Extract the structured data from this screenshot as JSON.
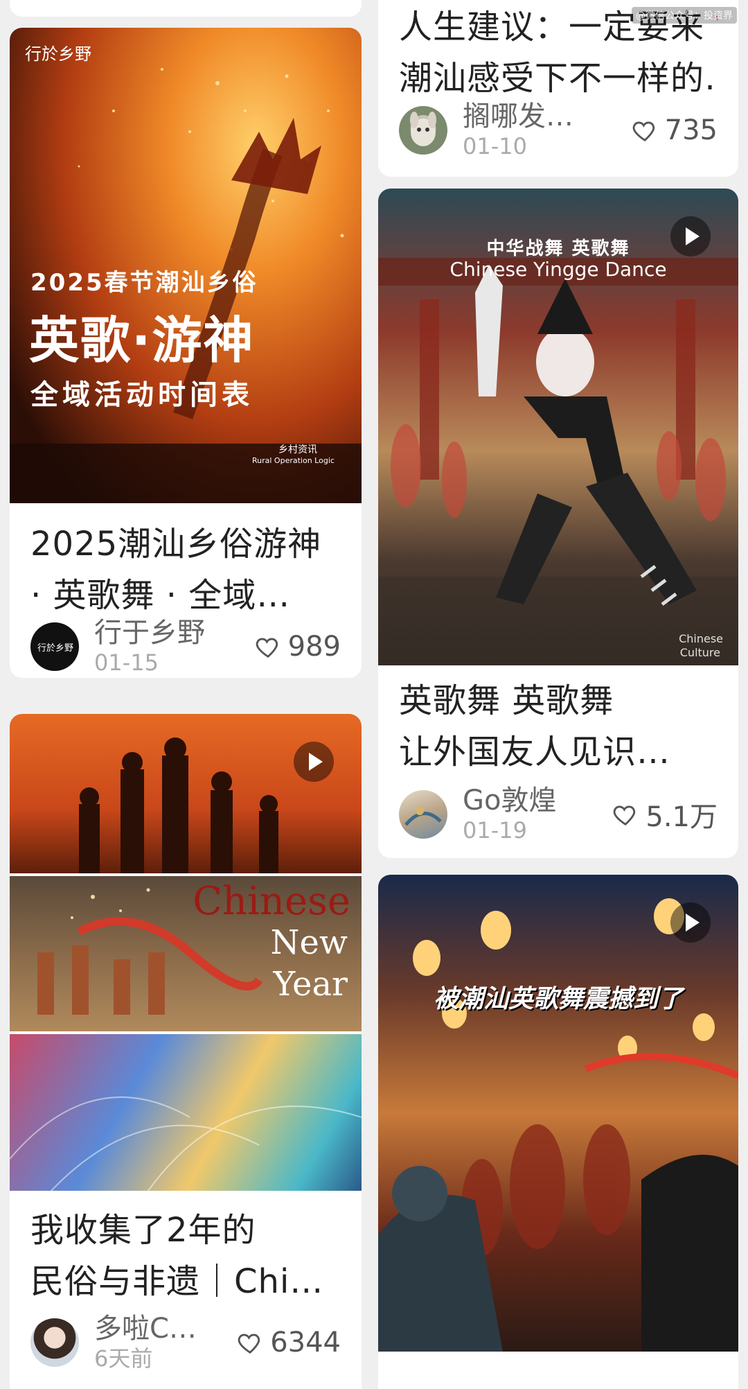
{
  "watermark": "@微信公众号：投资界",
  "cards": {
    "top_left": {
      "date_partial": ""
    },
    "top_right": {
      "title_line1": "人生建议：一定要来📍",
      "title_line2": "潮汕感受下不一样的…",
      "author": "搁哪发…",
      "date": "01-10",
      "likes": "735"
    },
    "c1": {
      "cover_logo": "行於乡野",
      "cover_headline1": "2025春节潮汕乡俗",
      "cover_headline2": "英歌·游神",
      "cover_headline3": "全域活动时间表",
      "cover_credit1": "乡村资讯",
      "cover_credit2": "Rural Operation Logic",
      "title_line1": "2025潮汕乡俗游神",
      "title_line2": "· 英歌舞 · 全域…",
      "author": "行于乡野",
      "date": "01-15",
      "likes": "989"
    },
    "c2": {
      "cover_cn": "中华战舞 英歌舞",
      "cover_en": "Chinese Yingge Dance",
      "cover_credit1": "Chinese",
      "cover_credit2": "Culture",
      "title_line1": "英歌舞 英歌舞",
      "title_line2": "让外国友人见识…",
      "author": "Go敦煌",
      "date": "01-19",
      "likes": "5.1万"
    },
    "c3": {
      "cover_word1": "Chinese",
      "cover_word2": "New",
      "cover_word3": "Year",
      "title_line1": "我收集了2年的",
      "title_line2": "民俗与非遗｜Chi…",
      "author": "多啦C…",
      "date": "6天前",
      "likes": "6344"
    },
    "c4": {
      "cover_caption": "被潮汕英歌舞震撼到了"
    }
  }
}
